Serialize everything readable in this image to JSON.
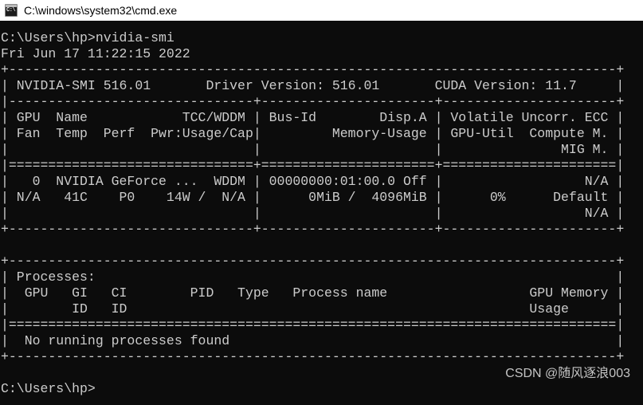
{
  "titlebar": {
    "title": "C:\\windows\\system32\\cmd.exe",
    "icon": "cmd-console-icon",
    "icon_text": "C:\\"
  },
  "console": {
    "prompt_command_line": "C:\\Users\\hp>nvidia-smi",
    "timestamp": "Fri Jun 17 11:22:15 2022",
    "final_prompt": "C:\\Users\\hp>",
    "background_color": "#0c0c0c",
    "text_color": "#cccccc",
    "lines": [
      "C:\\Users\\hp>nvidia-smi",
      "Fri Jun 17 11:22:15 2022",
      "+-----------------------------------------------------------------------------+",
      "| NVIDIA-SMI 516.01       Driver Version: 516.01       CUDA Version: 11.7     |",
      "|-------------------------------+----------------------+----------------------+",
      "| GPU  Name            TCC/WDDM | Bus-Id        Disp.A | Volatile Uncorr. ECC |",
      "| Fan  Temp  Perf  Pwr:Usage/Cap|         Memory-Usage | GPU-Util  Compute M. |",
      "|                               |                      |               MIG M. |",
      "|===============================+======================+======================|",
      "|   0  NVIDIA GeForce ...  WDDM | 00000000:01:00.0 Off |                  N/A |",
      "| N/A   41C    P0    14W /  N/A |      0MiB /  4096MiB |      0%      Default |",
      "|                               |                      |                  N/A |",
      "+-------------------------------+----------------------+----------------------+",
      "                                                                               ",
      "+-----------------------------------------------------------------------------+",
      "| Processes:                                                                  |",
      "|  GPU   GI   CI        PID   Type   Process name                  GPU Memory |",
      "|        ID   ID                                                   Usage      |",
      "|=============================================================================|",
      "|  No running processes found                                                 |",
      "+-----------------------------------------------------------------------------+",
      "",
      "C:\\Users\\hp>"
    ]
  },
  "smi_report": {
    "header": {
      "nvidia_smi_version_label": "NVIDIA-SMI",
      "nvidia_smi_version": "516.01",
      "driver_version_label": "Driver Version:",
      "driver_version": "516.01",
      "cuda_version_label": "CUDA Version:",
      "cuda_version": "11.7"
    },
    "gpu_table": {
      "columns_row1": [
        "GPU",
        "Name",
        "TCC/WDDM",
        "Bus-Id",
        "Disp.A",
        "Volatile Uncorr. ECC"
      ],
      "columns_row2": [
        "Fan",
        "Temp",
        "Perf",
        "Pwr:Usage/Cap",
        "Memory-Usage",
        "GPU-Util",
        "Compute M."
      ],
      "columns_row3": [
        "MIG M."
      ],
      "rows": [
        {
          "gpu": "0",
          "name": "NVIDIA GeForce ...",
          "tcc_wddm": "WDDM",
          "bus_id": "00000000:01:00.0",
          "disp_a": "Off",
          "ecc": "N/A",
          "fan": "N/A",
          "temp": "41C",
          "perf": "P0",
          "pwr_usage_cap": "14W /  N/A",
          "memory_usage": "0MiB /  4096MiB",
          "gpu_util": "0%",
          "compute_m": "Default",
          "mig_m": "N/A"
        }
      ]
    },
    "processes_table": {
      "section_label": "Processes:",
      "columns_row1": [
        "GPU",
        "GI",
        "CI",
        "PID",
        "Type",
        "Process name",
        "GPU Memory"
      ],
      "columns_row2": [
        "ID",
        "ID",
        "Usage"
      ],
      "empty_message": "No running processes found",
      "rows": []
    }
  },
  "watermark": {
    "text": "CSDN @随风逐浪003"
  }
}
